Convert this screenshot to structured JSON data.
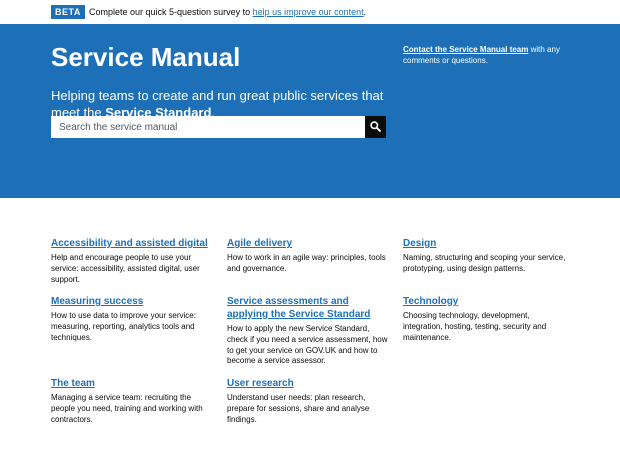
{
  "beta_banner": {
    "tag": "BETA",
    "text": "Complete our quick 5-question survey to ",
    "link": "help us improve our content",
    "suffix": "."
  },
  "header": {
    "title": "Service Manual",
    "contact_link": "Contact the Service Manual team",
    "contact_text": " with any comments or questions.",
    "lede_prefix": "Helping teams to create and run great public services that meet the ",
    "lede_link": "Service Standard",
    "lede_suffix": "."
  },
  "search": {
    "placeholder": "Search the service manual",
    "button_icon": "search-icon"
  },
  "topics": [
    {
      "title": "Accessibility and assisted digital",
      "description": "Help and encourage people to use your service: accessibility, assisted digital, user support."
    },
    {
      "title": "Agile delivery",
      "description": "How to work in an agile way: principles, tools and governance."
    },
    {
      "title": "Design",
      "description": "Naming, structuring and scoping your service, prototyping, using design patterns."
    },
    {
      "title": "Measuring success",
      "description": "How to use data to improve your service: measuring, reporting, analytics tools and techniques."
    },
    {
      "title": "Service assessments and applying the Service Standard",
      "description": "How to apply the new Service Standard, check if you need a service assessment, how to get your service on GOV.UK and how to become a service assessor."
    },
    {
      "title": "Technology",
      "description": "Choosing technology, development, integration, hosting, testing, security and maintenance."
    },
    {
      "title": "The team",
      "description": "Managing a service team: recruiting the people you need, training and working with contractors."
    },
    {
      "title": "User research",
      "description": "Understand user needs: plan research, prepare for sessions, share and analyse findings."
    }
  ],
  "colors": {
    "brand_blue": "#1d70b8",
    "text": "#0b0c0c",
    "search_button": "#0b0c0c"
  }
}
